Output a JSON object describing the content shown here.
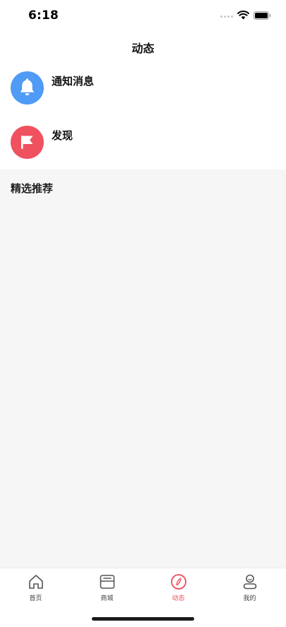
{
  "status_bar": {
    "time": "6:18"
  },
  "header": {
    "title": "动态"
  },
  "menu": {
    "items": [
      {
        "label": "通知消息",
        "icon": "bell-icon",
        "color": "#4f9bf5"
      },
      {
        "label": "发现",
        "icon": "flag-icon",
        "color": "#f0515f"
      }
    ]
  },
  "section": {
    "title": "精选推荐"
  },
  "tab_bar": {
    "active_color": "#ee4b5b",
    "tabs": [
      {
        "label": "首页",
        "icon": "home-icon",
        "active": false
      },
      {
        "label": "商城",
        "icon": "store-icon",
        "active": false
      },
      {
        "label": "动态",
        "icon": "compass-icon",
        "active": true
      },
      {
        "label": "我的",
        "icon": "profile-icon",
        "active": false
      }
    ]
  }
}
